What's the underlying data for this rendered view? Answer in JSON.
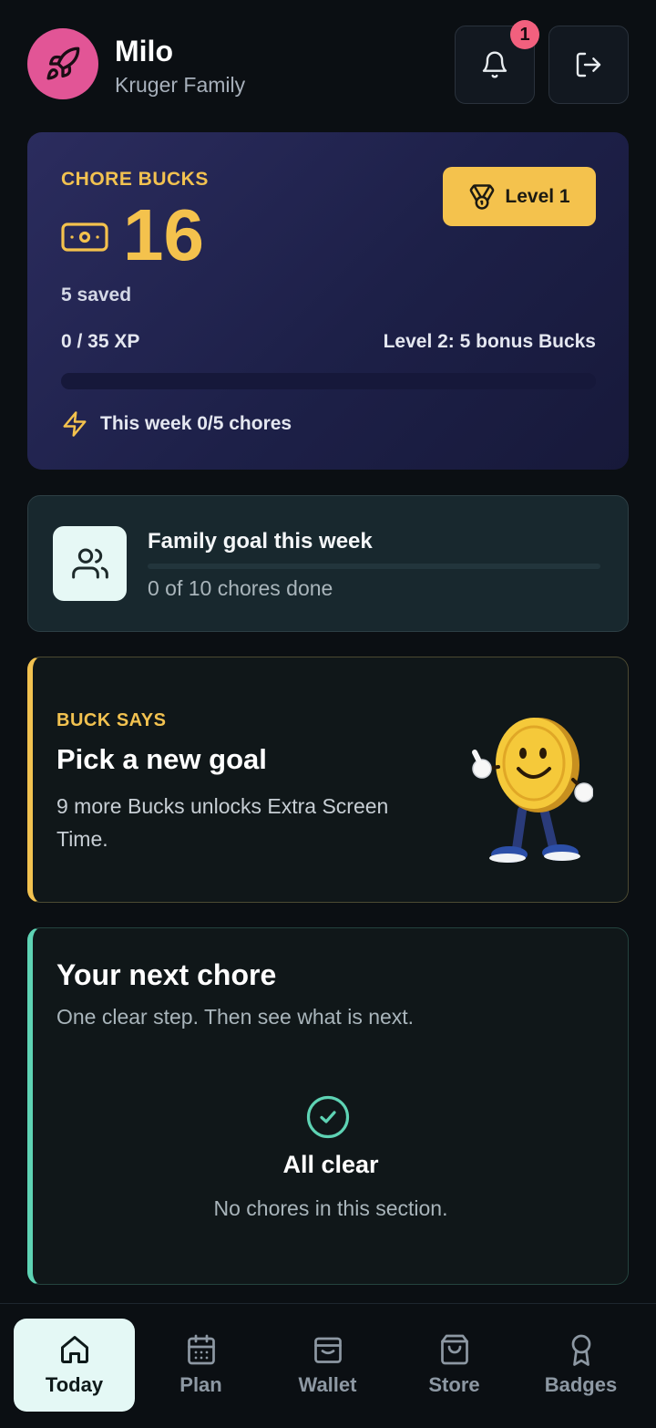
{
  "header": {
    "name": "Milo",
    "family": "Kruger Family",
    "notification_count": "1",
    "avatar_icon": "rocket-icon",
    "bell_icon": "bell-icon",
    "logout_icon": "logout-icon"
  },
  "bucks_card": {
    "label": "CHORE BUCKS",
    "value": "16",
    "saved": "5 saved",
    "level": "Level 1",
    "xp": "0 / 35 XP",
    "xp_progress": 0,
    "next_level": "Level 2: 5 bonus Bucks",
    "week": "This week 0/5 chores"
  },
  "family_goal": {
    "title": "Family goal this week",
    "progress_text": "0 of 10 chores done",
    "progress": 0
  },
  "buck_says": {
    "label": "BUCK SAYS",
    "title": "Pick a new goal",
    "message": "9 more Bucks unlocks Extra Screen Time."
  },
  "next_chore": {
    "title": "Your next chore",
    "subtitle": "One clear step. Then see what is next.",
    "empty_title": "All clear",
    "empty_text": "No chores in this section."
  },
  "nav": {
    "items": [
      {
        "label": "Today",
        "icon": "home-icon",
        "active": true
      },
      {
        "label": "Plan",
        "icon": "calendar-icon"
      },
      {
        "label": "Wallet",
        "icon": "wallet-icon"
      },
      {
        "label": "Store",
        "icon": "shopping-bag-icon"
      },
      {
        "label": "Badges",
        "icon": "award-icon"
      }
    ]
  },
  "colors": {
    "background": "#0b0f13",
    "accent_gold": "#f4c24d",
    "accent_teal": "#5ed3b4",
    "avatar_pink": "#e25596",
    "badge_red": "#f2607e"
  }
}
